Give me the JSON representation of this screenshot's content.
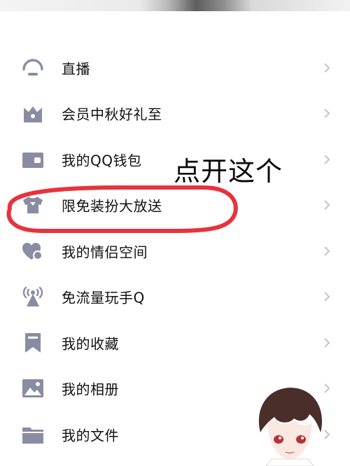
{
  "menu": {
    "items": [
      {
        "label": "直播",
        "icon": "live-broadcast-icon"
      },
      {
        "label": "会员中秋好礼至",
        "icon": "vip-crown-icon"
      },
      {
        "label": "我的QQ钱包",
        "icon": "wallet-icon"
      },
      {
        "label": "限免装扮大放送",
        "icon": "tshirt-icon"
      },
      {
        "label": "我的情侣空间",
        "icon": "couple-hearts-icon"
      },
      {
        "label": "免流量玩手Q",
        "icon": "signal-tower-icon"
      },
      {
        "label": "我的收藏",
        "icon": "bookmark-icon"
      },
      {
        "label": "我的相册",
        "icon": "photo-album-icon"
      },
      {
        "label": "我的文件",
        "icon": "folder-icon"
      }
    ]
  },
  "annotation": {
    "text": "点开这个",
    "highlight_color": "#e8323c"
  },
  "colors": {
    "icon": "#8a8ca3",
    "chevron": "#c4c4c4",
    "text": "#111111"
  }
}
